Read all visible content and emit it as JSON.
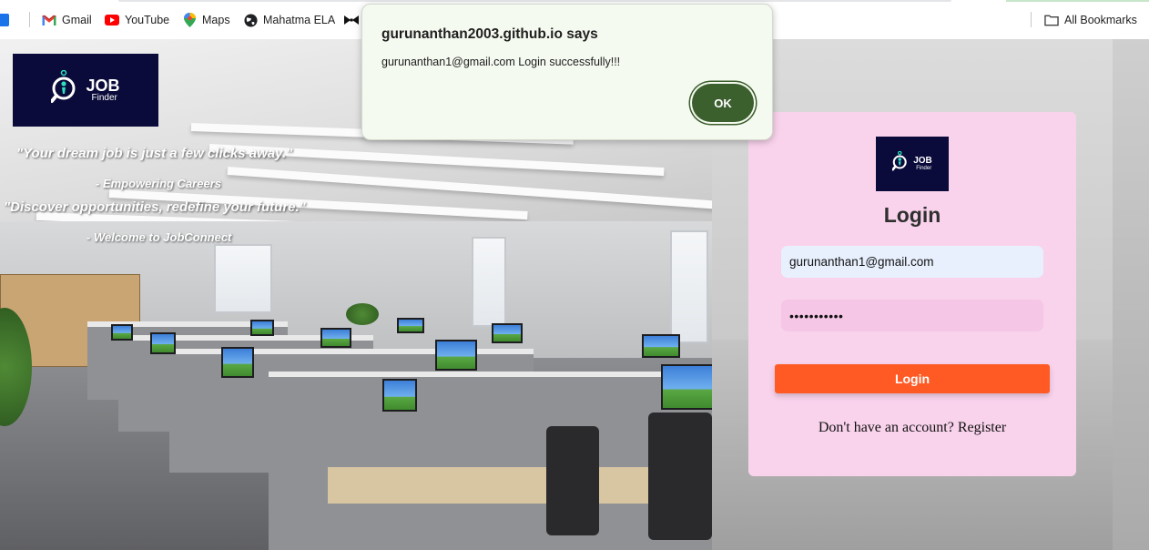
{
  "bookmarks_bar": {
    "items": [
      {
        "label": "Gmail",
        "icon": "gmail-icon"
      },
      {
        "label": "YouTube",
        "icon": "youtube-icon"
      },
      {
        "label": "Maps",
        "icon": "maps-icon"
      },
      {
        "label": "Mahatma ELA",
        "icon": "globe-icon"
      },
      {
        "label": "",
        "icon": "bow-icon"
      }
    ],
    "all_bookmarks": "All Bookmarks"
  },
  "hero": {
    "logo": {
      "line1": "JOB",
      "line2": "Finder"
    },
    "quote1": "\"Your dream job is just a few clicks away.\"",
    "attribution1": "- Empowering Careers",
    "quote2": "\"Discover opportunities, redefine your future.\"",
    "attribution2": "- Welcome to JobConnect"
  },
  "login_card": {
    "logo": {
      "line1": "JOB",
      "line2": "Finder"
    },
    "title": "Login",
    "email_value": "gurunanthan1@gmail.com",
    "password_masked": "•••••••••••",
    "login_button": "Login",
    "register_prompt": "Don't have an account?",
    "register_link": "Register"
  },
  "dialog": {
    "title": "gurunanthan2003.github.io says",
    "message": "gurunanthan1@gmail.com Login successfully!!!",
    "ok_button": "OK"
  },
  "colors": {
    "card_bg": "#f9d3ec",
    "login_button": "#ff5a24",
    "ok_button": "#3b5f2d",
    "logo_bg": "#0a0b3a"
  }
}
